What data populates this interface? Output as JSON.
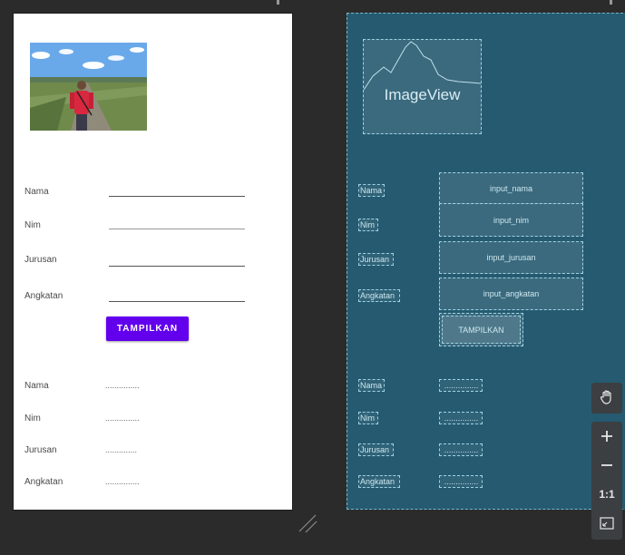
{
  "form": {
    "labels": {
      "nama": "Nama",
      "nim": "Nim",
      "jurusan": "Jurusan",
      "angkatan": "Angkatan"
    },
    "button_label": "TAMPILKAN",
    "result_placeholder": "...............",
    "result_placeholder_short": ".............."
  },
  "blueprint": {
    "image_view_label": "ImageView",
    "inputs": {
      "nama": "input_nama",
      "nim": "input_nim",
      "jurusan": "input_jurusan",
      "angkatan": "input_angkatan"
    },
    "button_label": "TAMPILKAN",
    "result_placeholder": "..............."
  },
  "toolbar": {
    "pan_icon": "hand-icon",
    "zoom_in_icon": "plus-icon",
    "zoom_out_icon": "minus-icon",
    "actual_size_label": "1:1",
    "fit_icon": "fit-screen-icon"
  },
  "colors": {
    "accent_button": "#6200ee",
    "blueprint_bg": "#255a70",
    "canvas_bg": "#2b2b2b"
  }
}
